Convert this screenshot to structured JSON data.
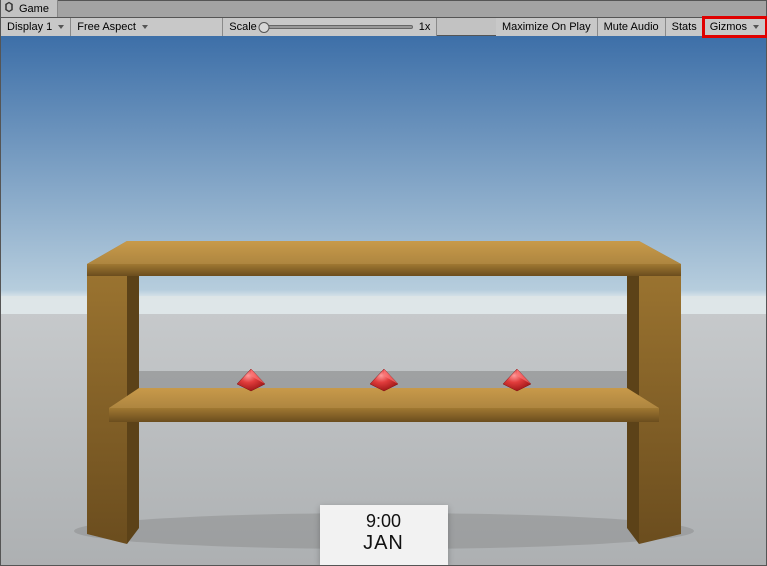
{
  "tab": {
    "label": "Game"
  },
  "toolbar": {
    "display": "Display 1",
    "aspect": "Free Aspect",
    "scale_label": "Scale",
    "scale_value": "1x",
    "maximize": "Maximize On Play",
    "mute": "Mute Audio",
    "stats": "Stats",
    "gizmos": "Gizmos"
  },
  "overlay": {
    "time": "9:00",
    "month": "JAN"
  }
}
